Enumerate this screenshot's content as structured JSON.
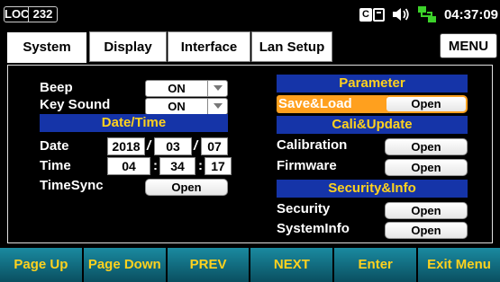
{
  "status": {
    "loc": "LOC",
    "loc_number": "232",
    "interface_icon_text": "C",
    "time": "04:37:09"
  },
  "tabs": [
    {
      "label": "System",
      "active": true
    },
    {
      "label": "Display",
      "active": false
    },
    {
      "label": "Interface",
      "active": false
    },
    {
      "label": "Lan Setup",
      "active": false
    }
  ],
  "menu_label": "MENU",
  "left": {
    "beep_label": "Beep",
    "beep_value": "ON",
    "keysound_label": "Key Sound",
    "keysound_value": "ON",
    "datetime_header": "Date/Time",
    "date_label": "Date",
    "date_year": "2018",
    "date_month": "03",
    "date_day": "07",
    "date_sep": "/",
    "time_label": "Time",
    "time_hour": "04",
    "time_minute": "34",
    "time_second": "17",
    "time_sep": ":",
    "timesync_label": "TimeSync",
    "timesync_button": "Open"
  },
  "right": {
    "parameter_header": "Parameter",
    "saveload_label": "Save&Load",
    "saveload_button": "Open",
    "cali_header": "Cali&Update",
    "calibration_label": "Calibration",
    "calibration_button": "Open",
    "firmware_label": "Firmware",
    "firmware_button": "Open",
    "security_header": "Security&Info",
    "security_label": "Security",
    "security_button": "Open",
    "systeminfo_label": "SystemInfo",
    "systeminfo_button": "Open"
  },
  "softkeys": [
    "Page Up",
    "Page Down",
    "PREV",
    "NEXT",
    "Enter",
    "Exit Menu"
  ],
  "colors": {
    "header_bg": "#1534a8",
    "header_text": "#ffd21e",
    "selected": "#ffa01e",
    "softkey_bg": "#0f6f84"
  }
}
